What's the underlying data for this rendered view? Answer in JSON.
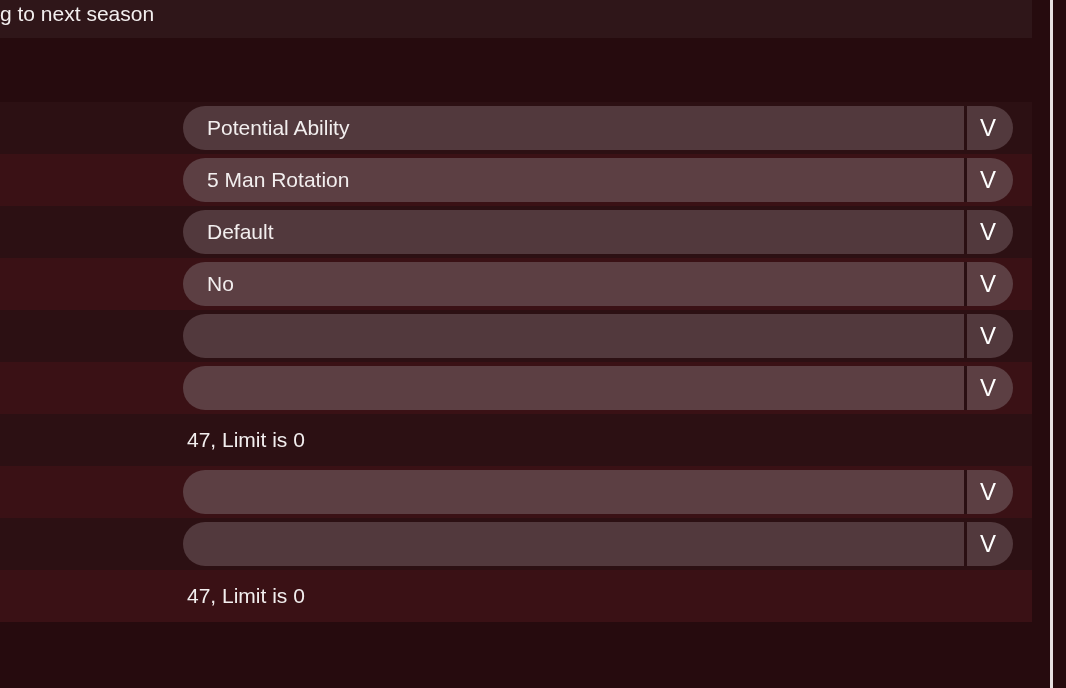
{
  "header": {
    "text": "g to next season"
  },
  "rows": [
    {
      "kind": "dropdown",
      "value": "Potential Ability",
      "arrow": "V"
    },
    {
      "kind": "dropdown",
      "value": "5 Man Rotation",
      "arrow": "V"
    },
    {
      "kind": "dropdown",
      "value": "Default",
      "arrow": "V"
    },
    {
      "kind": "dropdown",
      "value": "No",
      "arrow": "V"
    },
    {
      "kind": "dropdown",
      "value": "",
      "arrow": "V"
    },
    {
      "kind": "dropdown",
      "value": "",
      "arrow": "V"
    },
    {
      "kind": "text",
      "text": "47, Limit is 0"
    },
    {
      "kind": "dropdown",
      "value": "",
      "arrow": "V"
    },
    {
      "kind": "dropdown",
      "value": "",
      "arrow": "V"
    },
    {
      "kind": "text",
      "text": "47, Limit is 0"
    }
  ]
}
